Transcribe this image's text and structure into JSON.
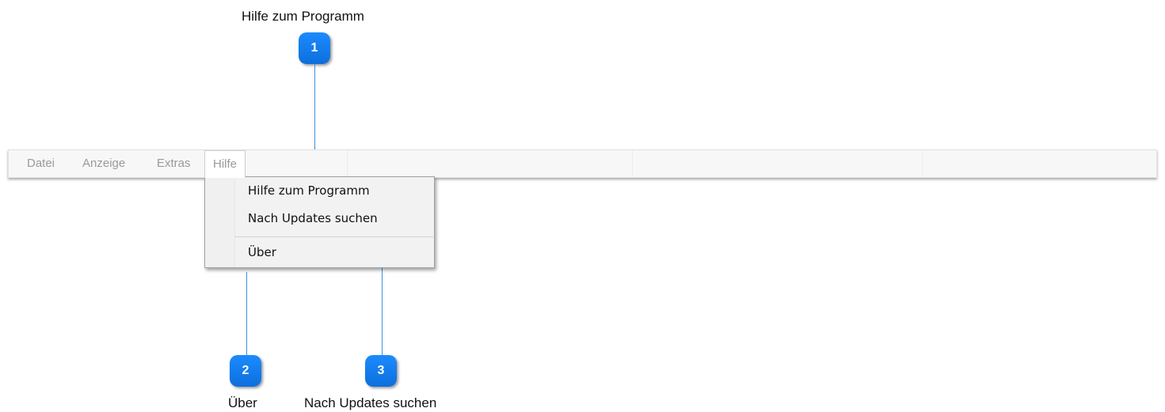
{
  "menubar": {
    "menus": [
      {
        "label": "Datei"
      },
      {
        "label": "Anzeige"
      },
      {
        "label": "Extras"
      },
      {
        "label": "Hilfe"
      }
    ]
  },
  "dropdown": {
    "items": [
      {
        "label": "Hilfe zum Programm"
      },
      {
        "label": "Nach Updates suchen"
      },
      {
        "label": "Über"
      }
    ]
  },
  "callouts": [
    {
      "number": "1",
      "label": "Hilfe zum Programm"
    },
    {
      "number": "2",
      "label": "Über"
    },
    {
      "number": "3",
      "label": "Nach Updates suchen"
    }
  ],
  "colors": {
    "marker": "#0d7bf0",
    "callout_line": "#3f8fe0",
    "menu_text_inactive": "#9a9a9a"
  }
}
